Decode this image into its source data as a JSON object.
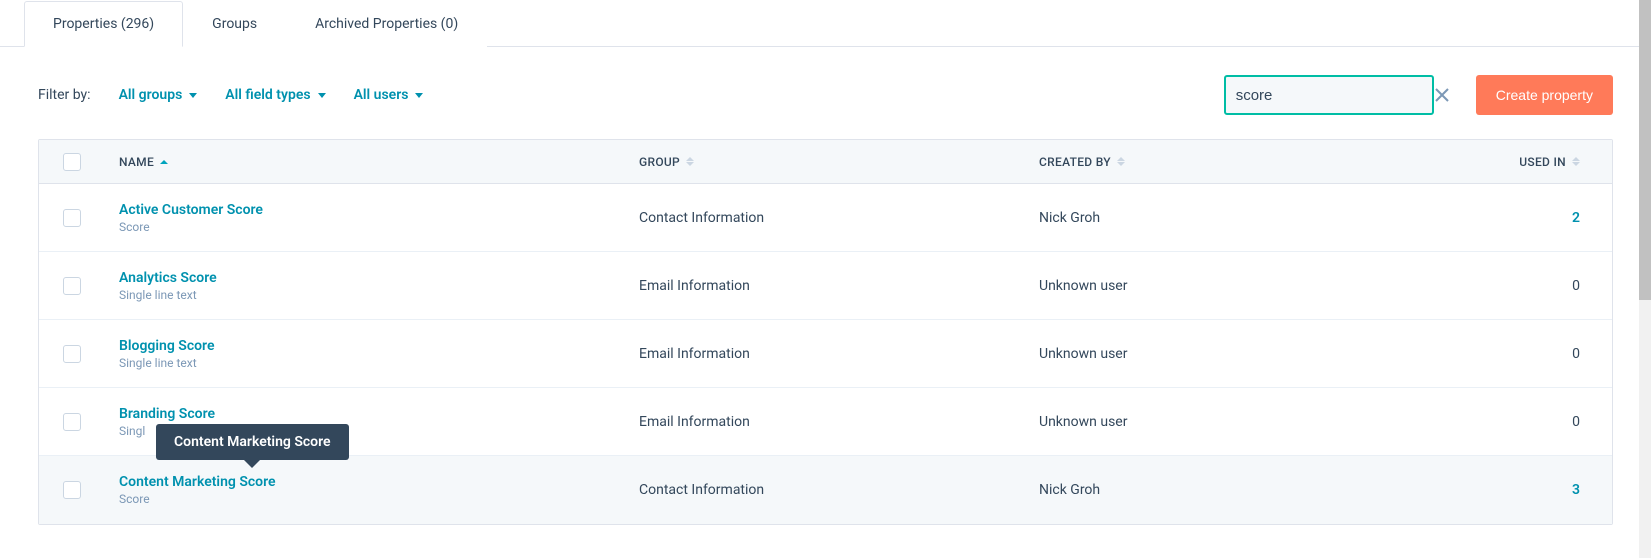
{
  "tabs": [
    {
      "label": "Properties (296)",
      "active": true
    },
    {
      "label": "Groups",
      "active": false
    },
    {
      "label": "Archived Properties (0)",
      "active": false
    }
  ],
  "filter": {
    "label": "Filter by:",
    "groups": "All groups",
    "fieldTypes": "All field types",
    "users": "All users"
  },
  "search": {
    "value": "score"
  },
  "createBtn": "Create property",
  "columns": {
    "name": "NAME",
    "group": "GROUP",
    "createdBy": "CREATED BY",
    "usedIn": "USED IN"
  },
  "rows": [
    {
      "name": "Active Customer Score",
      "type": "Score",
      "group": "Contact Information",
      "createdBy": "Nick Groh",
      "usedIn": "2",
      "usedLink": true
    },
    {
      "name": "Analytics Score",
      "type": "Single line text",
      "group": "Email Information",
      "createdBy": "Unknown user",
      "usedIn": "0",
      "usedLink": false
    },
    {
      "name": "Blogging Score",
      "type": "Single line text",
      "group": "Email Information",
      "createdBy": "Unknown user",
      "usedIn": "0",
      "usedLink": false
    },
    {
      "name": "Branding Score",
      "type": "Singl",
      "group": "Email Information",
      "createdBy": "Unknown user",
      "usedIn": "0",
      "usedLink": false
    },
    {
      "name": "Content Marketing Score",
      "type": "Score",
      "group": "Contact Information",
      "createdBy": "Nick Groh",
      "usedIn": "3",
      "usedLink": true,
      "hovered": true
    }
  ],
  "tooltip": {
    "text": "Content Marketing Score"
  }
}
